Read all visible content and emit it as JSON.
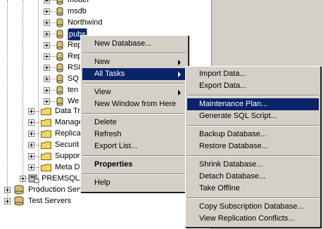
{
  "tree": {
    "databases": [
      {
        "label": "model"
      },
      {
        "label": "msdb"
      },
      {
        "label": "Northwind"
      },
      {
        "label": "pubs",
        "selected": true
      },
      {
        "label": "Rep"
      },
      {
        "label": "Rep"
      },
      {
        "label": "RSI"
      },
      {
        "label": "SQ"
      },
      {
        "label": "ten"
      },
      {
        "label": "We"
      }
    ],
    "folders": [
      {
        "label": "Data Tr"
      },
      {
        "label": "Manage"
      },
      {
        "label": "Replica"
      },
      {
        "label": "Securit"
      },
      {
        "label": "Suppor"
      },
      {
        "label": "Meta D"
      }
    ],
    "server_label": "PREMSQL2",
    "groups": [
      {
        "label": "Production Servers"
      },
      {
        "label": "Test Servers"
      }
    ]
  },
  "context_menu": {
    "items": {
      "new_database": "New Database...",
      "new": "New",
      "all_tasks": "All Tasks",
      "view": "View",
      "new_window": "New Window from Here",
      "delete": "Delete",
      "refresh": "Refresh",
      "export_list": "Export List...",
      "properties": "Properties",
      "help": "Help"
    }
  },
  "submenu": {
    "items": {
      "import_data": "Import Data...",
      "export_data": "Export Data...",
      "maintenance_plan": "Maintenance Plan...",
      "generate_sql": "Generate SQL Script...",
      "backup": "Backup Database...",
      "restore": "Restore Database...",
      "shrink": "Shrink Database...",
      "detach": "Detach Database...",
      "take_offline": "Take Offline",
      "copy_subscription": "Copy Subscription Database...",
      "view_replication": "View Replication Conflicts..."
    }
  },
  "colors": {
    "highlight": "#0a246a",
    "menu_bg": "#d4d0c8",
    "cylinder": "#d8c060"
  }
}
